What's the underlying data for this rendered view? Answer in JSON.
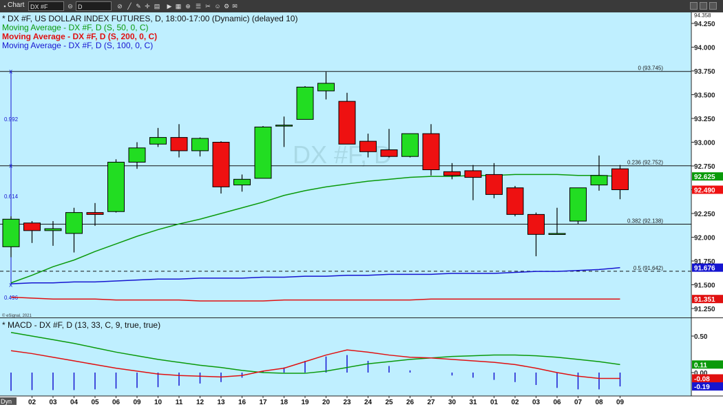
{
  "window": {
    "title": "Chart",
    "symbol_box": "DX #F",
    "interval_box": "D"
  },
  "chart_data": [
    {
      "type": "candlestick",
      "title": "* DX #F, US DOLLAR INDEX FUTURES, D, 18:00-17:00 (Dynamic) (delayed 10)",
      "watermark": "DX #F, D",
      "copyright": "© eSignal, 2021",
      "ylim": [
        91.1,
        94.3
      ],
      "yticks": [
        "94.250",
        "94.000",
        "93.750",
        "93.500",
        "93.250",
        "93.000",
        "92.750",
        "92.500",
        "92.250",
        "92.000",
        "91.750",
        "91.500",
        "91.250"
      ],
      "top_value": "94.358",
      "x": [
        "02",
        "03",
        "04",
        "05",
        "06",
        "09",
        "10",
        "11",
        "12",
        "13",
        "16",
        "17",
        "18",
        "19",
        "20",
        "23",
        "24",
        "25",
        "26",
        "27",
        "30",
        "31",
        "01",
        "02",
        "03",
        "06",
        "07",
        "08",
        "09"
      ],
      "candles": [
        {
          "o": 91.9,
          "h": 92.22,
          "l": 91.79,
          "c": 92.19
        },
        {
          "o": 92.15,
          "h": 92.17,
          "l": 91.94,
          "c": 92.07
        },
        {
          "o": 92.07,
          "h": 92.17,
          "l": 91.91,
          "c": 92.09
        },
        {
          "o": 92.04,
          "h": 92.31,
          "l": 91.84,
          "c": 92.26
        },
        {
          "o": 92.26,
          "h": 92.36,
          "l": 92.12,
          "c": 92.24
        },
        {
          "o": 92.27,
          "h": 92.82,
          "l": 92.26,
          "c": 92.79
        },
        {
          "o": 92.79,
          "h": 93.0,
          "l": 92.72,
          "c": 92.94
        },
        {
          "o": 92.98,
          "h": 93.15,
          "l": 92.95,
          "c": 93.05
        },
        {
          "o": 93.05,
          "h": 93.19,
          "l": 92.84,
          "c": 92.91
        },
        {
          "o": 92.91,
          "h": 93.05,
          "l": 92.85,
          "c": 93.04
        },
        {
          "o": 93.0,
          "h": 93.01,
          "l": 92.46,
          "c": 92.53
        },
        {
          "o": 92.55,
          "h": 92.66,
          "l": 92.48,
          "c": 92.61
        },
        {
          "o": 92.62,
          "h": 93.17,
          "l": 92.62,
          "c": 93.16
        },
        {
          "o": 93.17,
          "h": 93.27,
          "l": 92.95,
          "c": 93.18
        },
        {
          "o": 93.24,
          "h": 93.59,
          "l": 93.24,
          "c": 93.58
        },
        {
          "o": 93.54,
          "h": 93.74,
          "l": 93.45,
          "c": 93.62
        },
        {
          "o": 93.43,
          "h": 93.52,
          "l": 92.98,
          "c": 92.98
        },
        {
          "o": 93.01,
          "h": 93.09,
          "l": 92.84,
          "c": 92.9
        },
        {
          "o": 92.92,
          "h": 93.14,
          "l": 92.84,
          "c": 92.85
        },
        {
          "o": 92.85,
          "h": 93.09,
          "l": 92.84,
          "c": 93.09
        },
        {
          "o": 93.09,
          "h": 93.19,
          "l": 92.65,
          "c": 92.71
        },
        {
          "o": 92.69,
          "h": 92.78,
          "l": 92.61,
          "c": 92.65
        },
        {
          "o": 92.7,
          "h": 92.76,
          "l": 92.39,
          "c": 92.63
        },
        {
          "o": 92.66,
          "h": 92.78,
          "l": 92.41,
          "c": 92.45
        },
        {
          "o": 92.52,
          "h": 92.54,
          "l": 92.22,
          "c": 92.24
        },
        {
          "o": 92.24,
          "h": 92.26,
          "l": 91.8,
          "c": 92.03
        },
        {
          "o": 92.04,
          "h": 92.31,
          "l": 92.03,
          "c": 92.04
        },
        {
          "o": 92.17,
          "h": 92.52,
          "l": 92.14,
          "c": 92.52
        },
        {
          "o": 92.55,
          "h": 92.86,
          "l": 92.49,
          "c": 92.65
        },
        {
          "o": 92.72,
          "h": 92.76,
          "l": 92.4,
          "c": 92.5
        }
      ],
      "moving_averages": [
        {
          "name": "Moving Average - DX #F, D (S, 50, 0, C)",
          "color": "#0a9a0a",
          "last_label": "92.625",
          "points": [
            91.52,
            91.6,
            91.69,
            91.76,
            91.85,
            91.93,
            92.01,
            92.08,
            92.14,
            92.19,
            92.25,
            92.31,
            92.37,
            92.44,
            92.49,
            92.53,
            92.56,
            92.59,
            92.61,
            92.63,
            92.64,
            92.64,
            92.65,
            92.65,
            92.66,
            92.66,
            92.66,
            92.65,
            92.65,
            92.64
          ]
        },
        {
          "name": "Moving Average - DX #F, D (S, 200, 0, C)",
          "color": "#e01010",
          "last_label": "91.351",
          "points": [
            91.37,
            91.36,
            91.35,
            91.35,
            91.35,
            91.34,
            91.34,
            91.34,
            91.34,
            91.33,
            91.33,
            91.33,
            91.33,
            91.34,
            91.34,
            91.34,
            91.34,
            91.34,
            91.34,
            91.34,
            91.35,
            91.35,
            91.35,
            91.35,
            91.35,
            91.35,
            91.35,
            91.35,
            91.35,
            91.35
          ]
        },
        {
          "name": "Moving Average - DX #F, D (S, 100, 0, C)",
          "color": "#1515d0",
          "last_label": "91.676",
          "points": [
            91.51,
            91.52,
            91.52,
            91.53,
            91.53,
            91.54,
            91.55,
            91.56,
            91.56,
            91.57,
            91.57,
            91.57,
            91.58,
            91.58,
            91.59,
            91.59,
            91.6,
            91.6,
            91.61,
            91.61,
            91.61,
            91.62,
            91.62,
            91.62,
            91.63,
            91.64,
            91.64,
            91.65,
            91.66,
            91.68
          ]
        }
      ],
      "last_price_label": "92.490",
      "fibonacci": [
        {
          "label": "0 (93.745)",
          "value": 93.745,
          "style": "solid"
        },
        {
          "label": "0.236 (92.752)",
          "value": 92.752,
          "style": "solid"
        },
        {
          "label": "0.382 (92.138)",
          "value": 92.138,
          "style": "solid"
        },
        {
          "label": "0.5 (91.642)",
          "value": 91.642,
          "style": "dashed"
        }
      ],
      "measure": {
        "labels": [
          "0.992",
          "0.614",
          "0.496"
        ],
        "from": 91.5,
        "to": 93.745
      }
    },
    {
      "type": "macd",
      "title": "* MACD - DX #F, D (13, 33, C, 9, true, true)",
      "ylim": [
        -0.25,
        0.66
      ],
      "yticks": [
        "0.50",
        "0.00"
      ],
      "macd": {
        "color": "#e01010",
        "last_label": "-0.08",
        "points": [
          0.3,
          0.26,
          0.21,
          0.16,
          0.11,
          0.06,
          0.02,
          -0.02,
          -0.04,
          -0.05,
          -0.06,
          -0.04,
          0.02,
          0.06,
          0.15,
          0.24,
          0.31,
          0.28,
          0.24,
          0.21,
          0.2,
          0.18,
          0.16,
          0.14,
          0.11,
          0.06,
          0.0,
          -0.05,
          -0.08,
          -0.08
        ]
      },
      "signal": {
        "color": "#0a9a0a",
        "last_label": "0.11",
        "points": [
          0.55,
          0.5,
          0.45,
          0.4,
          0.34,
          0.28,
          0.23,
          0.18,
          0.14,
          0.1,
          0.07,
          0.03,
          0.0,
          -0.01,
          -0.01,
          0.02,
          0.07,
          0.12,
          0.15,
          0.18,
          0.2,
          0.22,
          0.23,
          0.24,
          0.24,
          0.23,
          0.21,
          0.18,
          0.15,
          0.11
        ]
      },
      "histogram": {
        "color": "#1515d0",
        "last_label": "-0.19",
        "values": [
          -0.25,
          -0.24,
          -0.24,
          -0.24,
          -0.23,
          -0.22,
          -0.21,
          -0.2,
          -0.18,
          -0.15,
          -0.13,
          -0.07,
          0.02,
          0.07,
          0.16,
          0.22,
          0.24,
          0.16,
          0.09,
          0.03,
          0.0,
          -0.04,
          -0.07,
          -0.1,
          -0.13,
          -0.17,
          -0.21,
          -0.23,
          -0.23,
          -0.19
        ]
      }
    }
  ],
  "xaxis_label": "Dyn"
}
